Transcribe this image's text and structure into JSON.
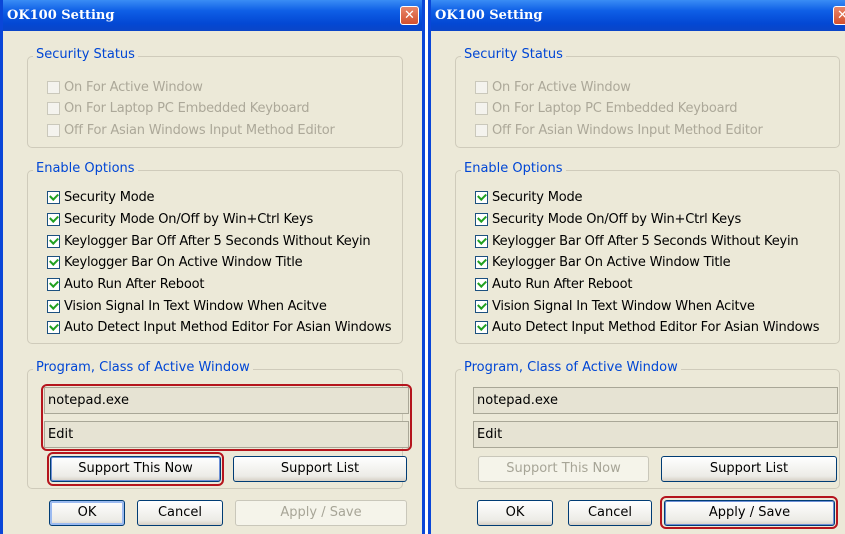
{
  "dialogs": [
    {
      "title": "OK100 Setting",
      "close_glyph": "✕",
      "security_status": {
        "label": "Security Status",
        "items": [
          "On For Active Window",
          "On For Laptop PC Embedded Keyboard",
          "Off For Asian Windows Input Method Editor"
        ]
      },
      "enable_options": {
        "label": "Enable Options",
        "items": [
          "Security Mode",
          "Security Mode On/Off by Win+Ctrl Keys",
          "Keylogger Bar Off After 5 Seconds Without Keyin",
          "Keylogger Bar On Active Window Title",
          "Auto Run After Reboot",
          "Vision Signal In Text Window When Acitve",
          "Auto Detect Input Method Editor For Asian Windows"
        ]
      },
      "program_class": {
        "label": "Program, Class of Active Window",
        "program": "notepad.exe",
        "class": "Edit"
      },
      "buttons": {
        "support_now": "Support This Now",
        "support_list": "Support List",
        "ok": "OK",
        "cancel": "Cancel",
        "apply": "Apply / Save"
      }
    },
    {
      "title": "OK100 Setting",
      "close_glyph": "✕",
      "security_status": {
        "label": "Security Status",
        "items": [
          "On For Active Window",
          "On For Laptop PC Embedded Keyboard",
          "Off For Asian Windows Input Method Editor"
        ]
      },
      "enable_options": {
        "label": "Enable Options",
        "items": [
          "Security Mode",
          "Security Mode On/Off by Win+Ctrl Keys",
          "Keylogger Bar Off After 5 Seconds Without Keyin",
          "Keylogger Bar On Active Window Title",
          "Auto Run After Reboot",
          "Vision Signal In Text Window When Acitve",
          "Auto Detect Input Method Editor For Asian Windows"
        ]
      },
      "program_class": {
        "label": "Program, Class of Active Window",
        "program": "notepad.exe",
        "class": "Edit"
      },
      "buttons": {
        "support_now": "Support This Now",
        "support_list": "Support List",
        "ok": "OK",
        "cancel": "Cancel",
        "apply": "Apply / Save"
      }
    }
  ],
  "colors": {
    "title_bar": "#0348d4",
    "group_label": "#0046d5",
    "highlight": "#b5151d",
    "check_mark": "#21a121",
    "dialog_bg": "#ece9d8"
  },
  "icons": {
    "close": "close-icon",
    "check": "check-icon"
  }
}
